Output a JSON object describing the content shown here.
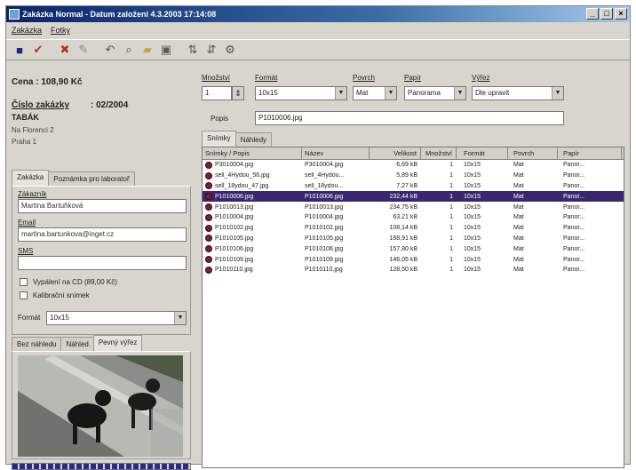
{
  "window": {
    "title": "Zakázka Normal - Datum založení 4.3.2003 17:14:08"
  },
  "menu": [
    "Zakázka",
    "Fotky"
  ],
  "toolbar": {
    "icons": [
      "save-icon",
      "check-icon",
      "delete-icon",
      "edit-icon",
      "back-icon",
      "search-icon",
      "folder-open-icon",
      "folder-icon",
      "sort-icon",
      "sort-desc-icon",
      "settings-icon"
    ]
  },
  "summary": {
    "price": "Cena : 108,90 Kč",
    "order_label": "Číslo zakázky",
    "order_no": ": 02/2004",
    "customer": "TABÁK",
    "address1": "Na Florenci 2",
    "address2": "Praha 1"
  },
  "left_tabs": [
    "Zakázka",
    "Poznámka pro laboratoř"
  ],
  "form": {
    "customer_label": "Zákazník",
    "customer_value": "Martina Bartuňková",
    "email_label": "Email",
    "email_value": "martina.bartunkova@inget.cz",
    "sms_label": "SMS",
    "sms_value": "",
    "cd_label": "Vypálení na CD (89,00 Kč)",
    "calib_label": "Kalibrační snímek",
    "format_label": "Formát",
    "format_value": "10x15"
  },
  "preview_tabs": [
    "Bez náhledu",
    "Náhled",
    "Pevný výřez"
  ],
  "controls": {
    "qty_label": "Množství",
    "qty_value": "1",
    "format_label": "Formát",
    "format_value": "10x15",
    "surface_label": "Povrch",
    "surface_value": "Mat",
    "paper_label": "Papír",
    "paper_value": "Panorama",
    "fit_label": "Výřez",
    "fit_value": "Dle upravit",
    "desc_label": "Popis",
    "desc_value": "P1010006.jpg"
  },
  "right_tabs": [
    "Snímky",
    "Náhledy"
  ],
  "table": {
    "columns": [
      "Snímky / Popis",
      "Název",
      "Velikost",
      "Množství",
      "Formát",
      "Povrch",
      "Papír"
    ],
    "rows": [
      [
        "P3010004.jpg",
        "P3010004.jpg",
        "6,69 kB",
        "1",
        "10x15",
        "Mat",
        "Panor..."
      ],
      [
        "sell_4Hydou_56.jpg",
        "sell_4Hydou...",
        "5,89 kB",
        "1",
        "10x15",
        "Mat",
        "Panor..."
      ],
      [
        "sell_18ydou_47.jpg",
        "sell_18ydou...",
        "7,27 kB",
        "1",
        "10x15",
        "Mat",
        "Panor..."
      ],
      [
        "P1010006.jpg",
        "P1010006.jpg",
        "232,44 kB",
        "1",
        "10x15",
        "Mat",
        "Panor..."
      ],
      [
        "P1010013.jpg",
        "P1010013.jpg",
        "234,75 kB",
        "1",
        "10x15",
        "Mat",
        "Panor..."
      ],
      [
        "P1010004.jpg",
        "P1010004.jpg",
        "63,21 kB",
        "1",
        "10x15",
        "Mat",
        "Panor..."
      ],
      [
        "P1010102.jpg",
        "P1010102.jpg",
        "108,14 kB",
        "1",
        "10x15",
        "Mat",
        "Panor..."
      ],
      [
        "P1010105.jpg",
        "P1010105.jpg",
        "168,91 kB",
        "1",
        "10x15",
        "Mat",
        "Panor..."
      ],
      [
        "P1010106.jpg",
        "P1010106.jpg",
        "157,80 kB",
        "1",
        "10x15",
        "Mat",
        "Panor..."
      ],
      [
        "P1010109.jpg",
        "P1010109.jpg",
        "146,05 kB",
        "1",
        "10x15",
        "Mat",
        "Panor..."
      ],
      [
        "P1010110.jpg",
        "P1010110.jpg",
        "128,50 kB",
        "1",
        "10x15",
        "Mat",
        "Panor..."
      ]
    ],
    "selected_index": 3
  },
  "colors": {
    "title_bar": "#0a246a",
    "selection": "#3a2770",
    "progress": "#2a2a8a"
  }
}
